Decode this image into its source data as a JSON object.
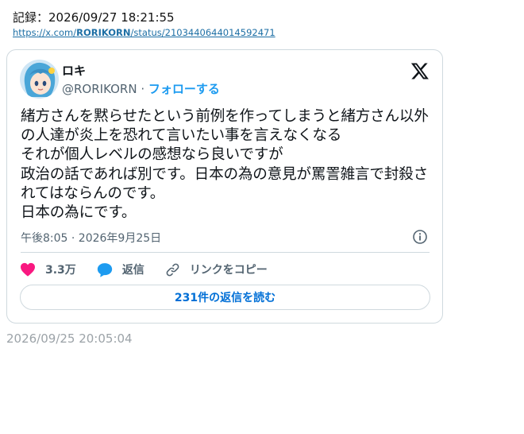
{
  "header": {
    "record_text": "記録：2026/09/27 18:21:55",
    "url_prefix": "https://x.com/",
    "url_user": "RORIKORN",
    "url_suffix": "/status/2103440644014592471"
  },
  "tweet": {
    "display_name": "ロキ",
    "handle": "@RORIKORN",
    "separator": "·",
    "follow_label": "フォローする",
    "text": "緒方さんを黙らせたという前例を作ってしまうと緒方さん以外の人達が炎上を恐れて言いたい事を言えなくなる\nそれが個人レベルの感想なら良いですが\n政治の話であれば別です。日本の為の意見が罵詈雑言で封殺されてはならんのです。\n日本の為にです。",
    "timestamp": "午後8:05 · 2026年9月25日",
    "likes": "3.3万",
    "reply_label": "返信",
    "copy_link_label": "リンクをコピー",
    "read_replies_label": "231件の返信を読む"
  },
  "footer": {
    "posted_at": "2026/09/25 20:05:04"
  },
  "colors": {
    "accent": "#1d9bf0",
    "heart": "#f91880",
    "muted": "#536471",
    "border": "#cfd9de"
  },
  "icons": [
    "avatar",
    "x-logo-icon",
    "info-icon",
    "heart-icon",
    "reply-bubble-icon",
    "link-icon"
  ]
}
